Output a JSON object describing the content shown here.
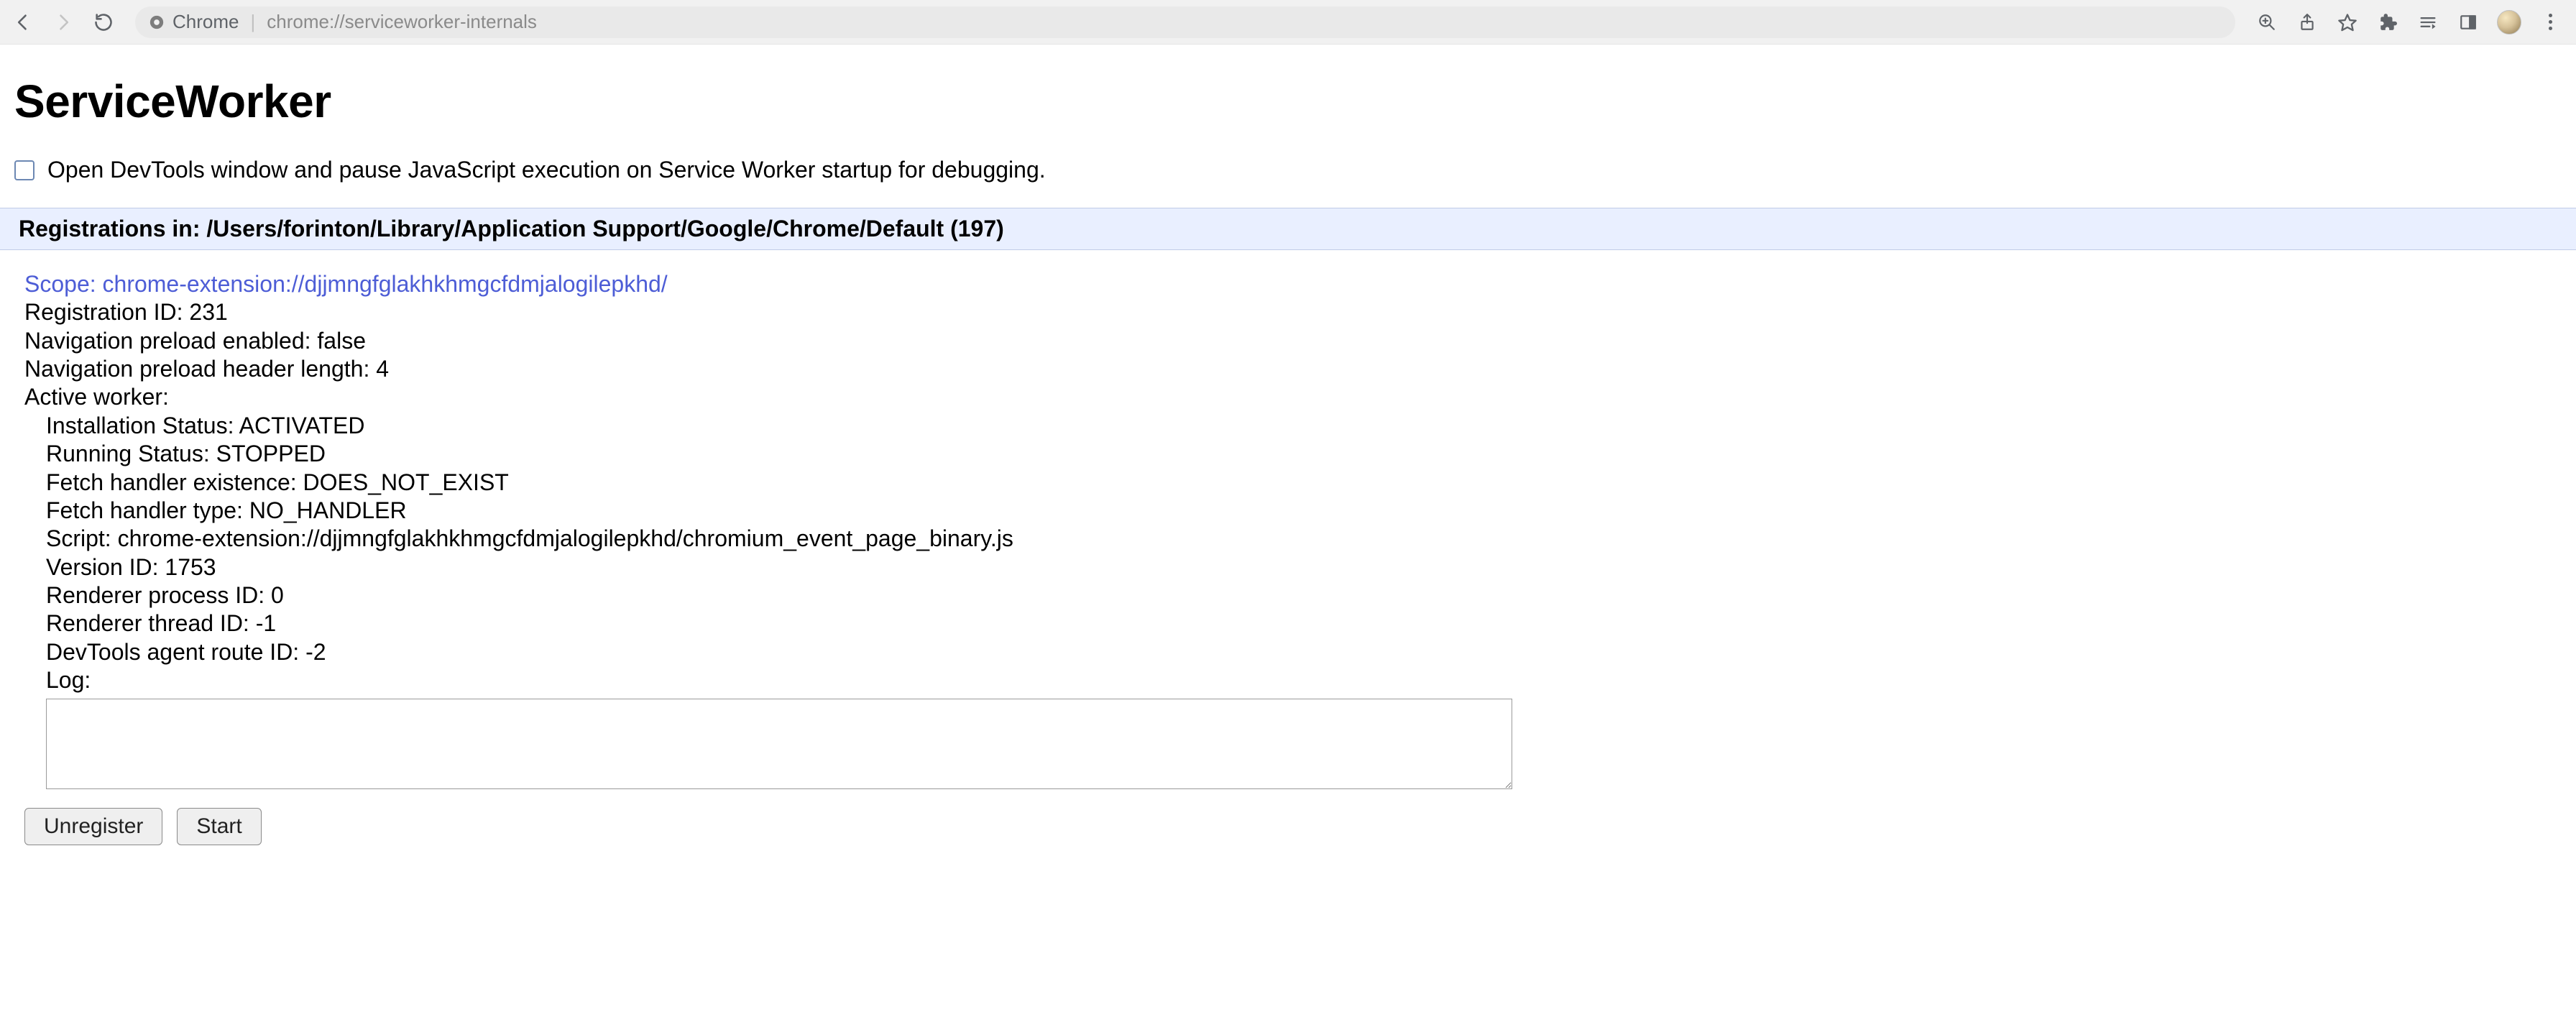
{
  "browser": {
    "origin_label": "Chrome",
    "url": "chrome://serviceworker-internals"
  },
  "page": {
    "title": "ServiceWorker",
    "debug_checkbox_label": "Open DevTools window and pause JavaScript execution on Service Worker startup for debugging."
  },
  "registrations_header": {
    "prefix": "Registrations in: ",
    "path": "/Users/forinton/Library/Application Support/Google/Chrome/Default",
    "count_suffix": " (197)"
  },
  "registration": {
    "scope_label": "Scope: ",
    "scope_url": "chrome-extension://djjmngfglakhkhmgcfdmjalogilepkhd/",
    "registration_id_label": "Registration ID: ",
    "registration_id": "231",
    "nav_preload_enabled_label": "Navigation preload enabled: ",
    "nav_preload_enabled": "false",
    "nav_preload_header_len_label": "Navigation preload header length: ",
    "nav_preload_header_len": "4",
    "active_worker_label": "Active worker:",
    "installation_status_label": "Installation Status: ",
    "installation_status": "ACTIVATED",
    "running_status_label": "Running Status: ",
    "running_status": "STOPPED",
    "fetch_handler_existence_label": "Fetch handler existence: ",
    "fetch_handler_existence": "DOES_NOT_EXIST",
    "fetch_handler_type_label": "Fetch handler type: ",
    "fetch_handler_type": "NO_HANDLER",
    "script_label": "Script: ",
    "script": "chrome-extension://djjmngfglakhkhmgcfdmjalogilepkhd/chromium_event_page_binary.js",
    "version_id_label": "Version ID: ",
    "version_id": "1753",
    "renderer_pid_label": "Renderer process ID: ",
    "renderer_pid": "0",
    "renderer_tid_label": "Renderer thread ID: ",
    "renderer_tid": "-1",
    "devtools_route_label": "DevTools agent route ID: ",
    "devtools_route": "-2",
    "log_label": "Log:",
    "log_value": ""
  },
  "buttons": {
    "unregister": "Unregister",
    "start": "Start"
  }
}
